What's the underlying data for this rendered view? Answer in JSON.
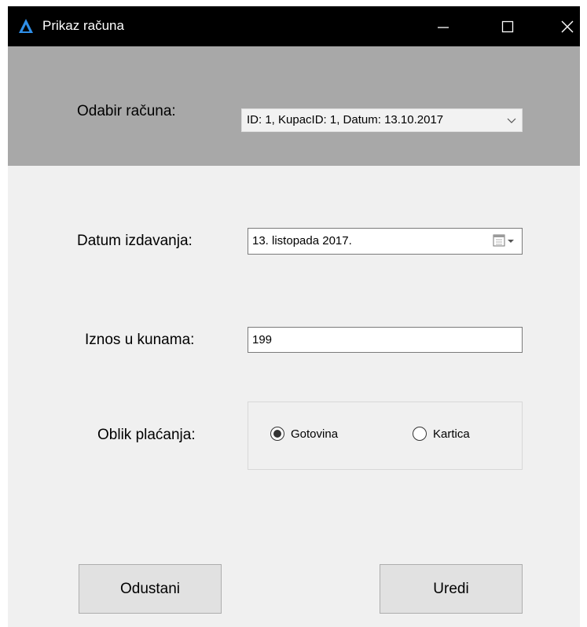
{
  "window": {
    "title": "Prikaz računa",
    "icon": "app-triangle-icon",
    "controls": {
      "minimize": "minimize-icon",
      "maximize": "maximize-icon",
      "close": "close-icon"
    }
  },
  "header": {
    "invoice_label": "Odabir računa:",
    "invoice_selected": "ID: 1, KupacID: 1, Datum: 13.10.2017"
  },
  "form": {
    "date_label": "Datum izdavanja:",
    "date_value": "13. listopada 2017.",
    "amount_label": "Iznos u kunama:",
    "amount_value": "199",
    "payment_label": "Oblik plaćanja:",
    "payment_options": [
      {
        "label": "Gotovina",
        "checked": true
      },
      {
        "label": "Kartica",
        "checked": false
      }
    ]
  },
  "buttons": {
    "cancel": "Odustani",
    "edit": "Uredi"
  },
  "colors": {
    "titlebar": "#000000",
    "header_panel": "#a8a8a8",
    "body": "#f0f0f0",
    "app_icon": "#2f8fe8"
  }
}
